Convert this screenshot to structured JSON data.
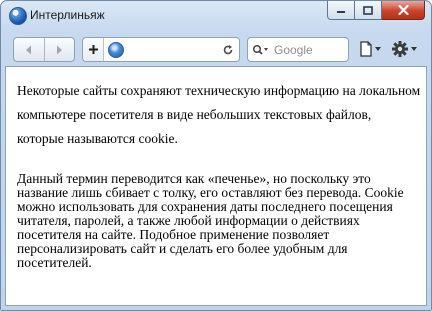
{
  "window": {
    "title": "Интерлиньяж",
    "app_icon": "browser-globe-icon",
    "controls": [
      "minimize-icon",
      "maximize-icon",
      "close-icon"
    ]
  },
  "toolbar": {
    "back_icon": "back-arrow-icon",
    "forward_icon": "forward-arrow-icon",
    "new_tab_icon": "plus-icon",
    "address": {
      "value": "",
      "site_icon": "globe-icon"
    },
    "reload_icon": "reload-icon",
    "search": {
      "placeholder": "Google",
      "icon": "magnifier-icon"
    },
    "page_menu_icon": "page-icon",
    "tools_menu_icon": "gear-icon"
  },
  "content": {
    "paragraph1": "Некоторые сайты сохраняют техническую информацию на локальном компьютере посетителя в виде небольших текстовых файлов, которые называются cookie.",
    "paragraph2": "Данный термин переводится как «печенье», но поскольку это название лишь сбивает с толку, его оставляют без перевода. Cookie можно использовать для сохранения даты последнего посещения читателя, паролей, а также любой информации о действиях посетителя на сайте. Подобное применение позволяет персонализировать сайт и сделать его более удобным для посетителей."
  },
  "colors": {
    "frame": "#c7d9ee",
    "close_button": "#c8452c",
    "content_background": "#ffffff"
  }
}
